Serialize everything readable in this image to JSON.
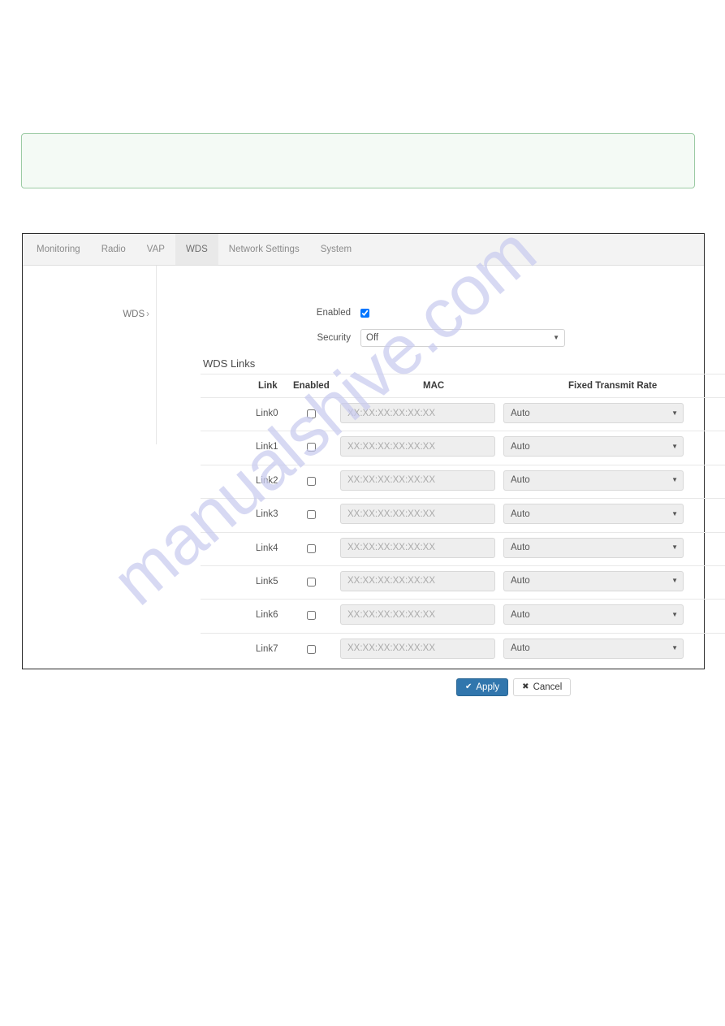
{
  "watermark": {
    "text": "manualshive.com"
  },
  "alert": {
    "text": ""
  },
  "tabs": [
    {
      "label": "Monitoring",
      "active": false
    },
    {
      "label": "Radio",
      "active": false
    },
    {
      "label": "VAP",
      "active": false
    },
    {
      "label": "WDS",
      "active": true
    },
    {
      "label": "Network Settings",
      "active": false
    },
    {
      "label": "System",
      "active": false
    }
  ],
  "sidebar": {
    "link_label": "WDS",
    "chevron": "›"
  },
  "form": {
    "enabled_label": "Enabled",
    "enabled_checked": true,
    "security_label": "Security",
    "security_value": "Off",
    "security_options": [
      "Off"
    ]
  },
  "links_section": {
    "heading": "WDS Links",
    "columns": [
      "Link",
      "Enabled",
      "MAC",
      "Fixed Transmit Rate"
    ],
    "mac_placeholder": "XX:XX:XX:XX:XX:XX",
    "rate_options": [
      "Auto"
    ],
    "rows": [
      {
        "link": "Link0",
        "enabled": false,
        "mac": "",
        "rate": "Auto"
      },
      {
        "link": "Link1",
        "enabled": false,
        "mac": "",
        "rate": "Auto"
      },
      {
        "link": "Link2",
        "enabled": false,
        "mac": "",
        "rate": "Auto"
      },
      {
        "link": "Link3",
        "enabled": false,
        "mac": "",
        "rate": "Auto"
      },
      {
        "link": "Link4",
        "enabled": false,
        "mac": "",
        "rate": "Auto"
      },
      {
        "link": "Link5",
        "enabled": false,
        "mac": "",
        "rate": "Auto"
      },
      {
        "link": "Link6",
        "enabled": false,
        "mac": "",
        "rate": "Auto"
      },
      {
        "link": "Link7",
        "enabled": false,
        "mac": "",
        "rate": "Auto"
      }
    ]
  },
  "actions": {
    "apply_label": "Apply",
    "apply_icon": "✔",
    "cancel_label": "Cancel",
    "cancel_icon": "✖"
  },
  "colors": {
    "apply_bg": "#3176ad",
    "alert_border": "#9ccba4",
    "alert_bg": "#f4faf5",
    "watermark": "#c9cbef"
  }
}
